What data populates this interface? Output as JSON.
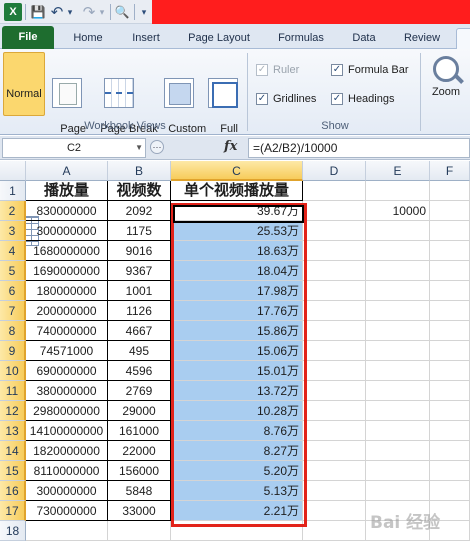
{
  "qat": {
    "logo": "X",
    "save": "💾",
    "undo": "↶",
    "undo_dd": "▾",
    "redo": "↷",
    "redo_dd": "▾",
    "preview": "🔍",
    "customize": "▾"
  },
  "tabs": [
    {
      "label": "File"
    },
    {
      "label": "Home"
    },
    {
      "label": "Insert"
    },
    {
      "label": "Page Layout"
    },
    {
      "label": "Formulas"
    },
    {
      "label": "Data"
    },
    {
      "label": "Review"
    }
  ],
  "ribbon": {
    "buttons": [
      {
        "label": "Normal"
      },
      {
        "label": "Page\nLayout"
      },
      {
        "label": "Page Break\nPreview"
      },
      {
        "label": "Custom\nViews"
      },
      {
        "label": "Full\nScreen"
      }
    ],
    "workbook_views_label": "Workbook Views",
    "ruler": "Ruler",
    "formula_bar": "Formula Bar",
    "gridlines": "Gridlines",
    "headings": "Headings",
    "show_label": "Show",
    "zoom": "Zoom",
    "check": "✓"
  },
  "formula_bar": {
    "name_box": "C2",
    "name_arrow": "▼",
    "circle": "⋯",
    "fx": "fx",
    "formula": "=(A2/B2)/10000"
  },
  "grid": {
    "columns": [
      "A",
      "B",
      "C",
      "D",
      "E",
      "F"
    ],
    "headers": {
      "a": "播放量",
      "b": "视频数",
      "c": "单个视频播放量"
    },
    "rows": [
      {
        "n": "1"
      },
      {
        "n": "2",
        "a": "830000000",
        "b": "2092",
        "c": "39.67万",
        "e": "10000"
      },
      {
        "n": "3",
        "a": "300000000",
        "b": "1175",
        "c": "25.53万"
      },
      {
        "n": "4",
        "a": "1680000000",
        "b": "9016",
        "c": "18.63万"
      },
      {
        "n": "5",
        "a": "1690000000",
        "b": "9367",
        "c": "18.04万"
      },
      {
        "n": "6",
        "a": "180000000",
        "b": "1001",
        "c": "17.98万"
      },
      {
        "n": "7",
        "a": "200000000",
        "b": "1126",
        "c": "17.76万"
      },
      {
        "n": "8",
        "a": "740000000",
        "b": "4667",
        "c": "15.86万"
      },
      {
        "n": "9",
        "a": "74571000",
        "b": "495",
        "c": "15.06万"
      },
      {
        "n": "10",
        "a": "690000000",
        "b": "4596",
        "c": "15.01万"
      },
      {
        "n": "11",
        "a": "380000000",
        "b": "2769",
        "c": "13.72万"
      },
      {
        "n": "12",
        "a": "2980000000",
        "b": "29000",
        "c": "10.28万"
      },
      {
        "n": "13",
        "a": "14100000000",
        "b": "161000",
        "c": "8.76万"
      },
      {
        "n": "14",
        "a": "1820000000",
        "b": "22000",
        "c": "8.27万"
      },
      {
        "n": "15",
        "a": "8110000000",
        "b": "156000",
        "c": "5.20万"
      },
      {
        "n": "16",
        "a": "300000000",
        "b": "5848",
        "c": "5.13万"
      },
      {
        "n": "17",
        "a": "730000000",
        "b": "33000",
        "c": "2.21万"
      },
      {
        "n": "18"
      }
    ]
  },
  "watermark": "Bai 经验"
}
